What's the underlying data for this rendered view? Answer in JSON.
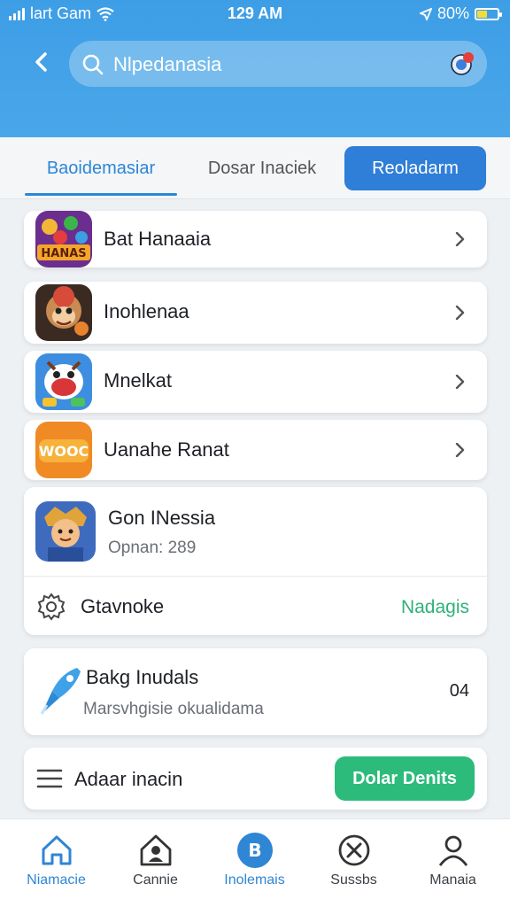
{
  "status_bar": {
    "carrier": "lart Gam",
    "time": "129 AM",
    "battery": "80%"
  },
  "header": {
    "search_text": "Nlpedanasia"
  },
  "tabs": {
    "tab1": "Baoidemasiar",
    "tab2": "Dosar Inaciek",
    "button": "Reoladarm"
  },
  "list": [
    {
      "label": "Bat Hanaaia",
      "icon": "puzzle-game-icon"
    },
    {
      "label": "Inohlenaa",
      "icon": "monkey-game-icon"
    },
    {
      "label": "Mnelkat",
      "icon": "cartoon-face-icon"
    },
    {
      "label": "Uanahe Ranat",
      "icon": "wooc-logo-icon"
    }
  ],
  "detail_card": {
    "title": "Gon INessia",
    "subtitle": "Opnan: 289",
    "setting_label": "Gtavnoke",
    "setting_value": "Nadagis"
  },
  "rocket_card": {
    "title": "Bakg Inudals",
    "subtitle": "Marsvhgisie okualidama",
    "count": "04"
  },
  "menu_card": {
    "label": "Adaar inacin",
    "button": "Dolar Denits"
  },
  "bottom_nav": [
    {
      "label": "Niamacie",
      "icon": "home-icon"
    },
    {
      "label": "Cannie",
      "icon": "house-person-icon"
    },
    {
      "label": "Inolemais",
      "icon": "b-circle-icon"
    },
    {
      "label": "Sussbs",
      "icon": "crossed-circle-icon"
    },
    {
      "label": "Manaia",
      "icon": "person-icon"
    }
  ],
  "colors": {
    "header": "#3d9ee6",
    "accent": "#2f7ed8",
    "green": "#2dbb7b"
  }
}
